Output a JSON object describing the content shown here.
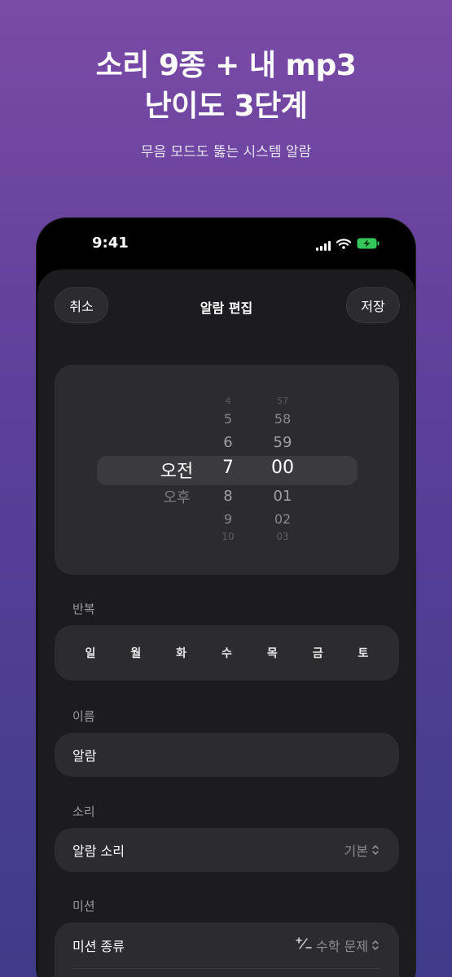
{
  "promo": {
    "headline_line1": "소리 9종 + 내 mp3",
    "headline_line2": "난이도 3단계",
    "subhead": "무음 모드도 뚫는 시스템 알람"
  },
  "status_bar": {
    "time": "9:41"
  },
  "sheet": {
    "cancel_label": "취소",
    "title": "알람 편집",
    "save_label": "저장"
  },
  "time_picker": {
    "ampm_selected": "오전",
    "ampm_other": "오후",
    "hours_above": [
      "4",
      "5",
      "6"
    ],
    "hour_selected": "7",
    "hours_below": [
      "8",
      "9",
      "10"
    ],
    "minutes_above": [
      "57",
      "58",
      "59"
    ],
    "minute_selected": "00",
    "minutes_below": [
      "01",
      "02",
      "03"
    ]
  },
  "repeat": {
    "label": "반복",
    "days": [
      "일",
      "월",
      "화",
      "수",
      "목",
      "금",
      "토"
    ]
  },
  "name": {
    "label": "이름",
    "value": "알람"
  },
  "sound": {
    "label": "소리",
    "row_label": "알람 소리",
    "value": "기본"
  },
  "mission": {
    "label": "미션",
    "row_label": "미션 종류",
    "value": "수학 문제",
    "icon": "plus-minus-icon"
  },
  "colors": {
    "accent_battery": "#35c759",
    "card": "#2c2c2e",
    "sheet": "#1c1c1e"
  }
}
